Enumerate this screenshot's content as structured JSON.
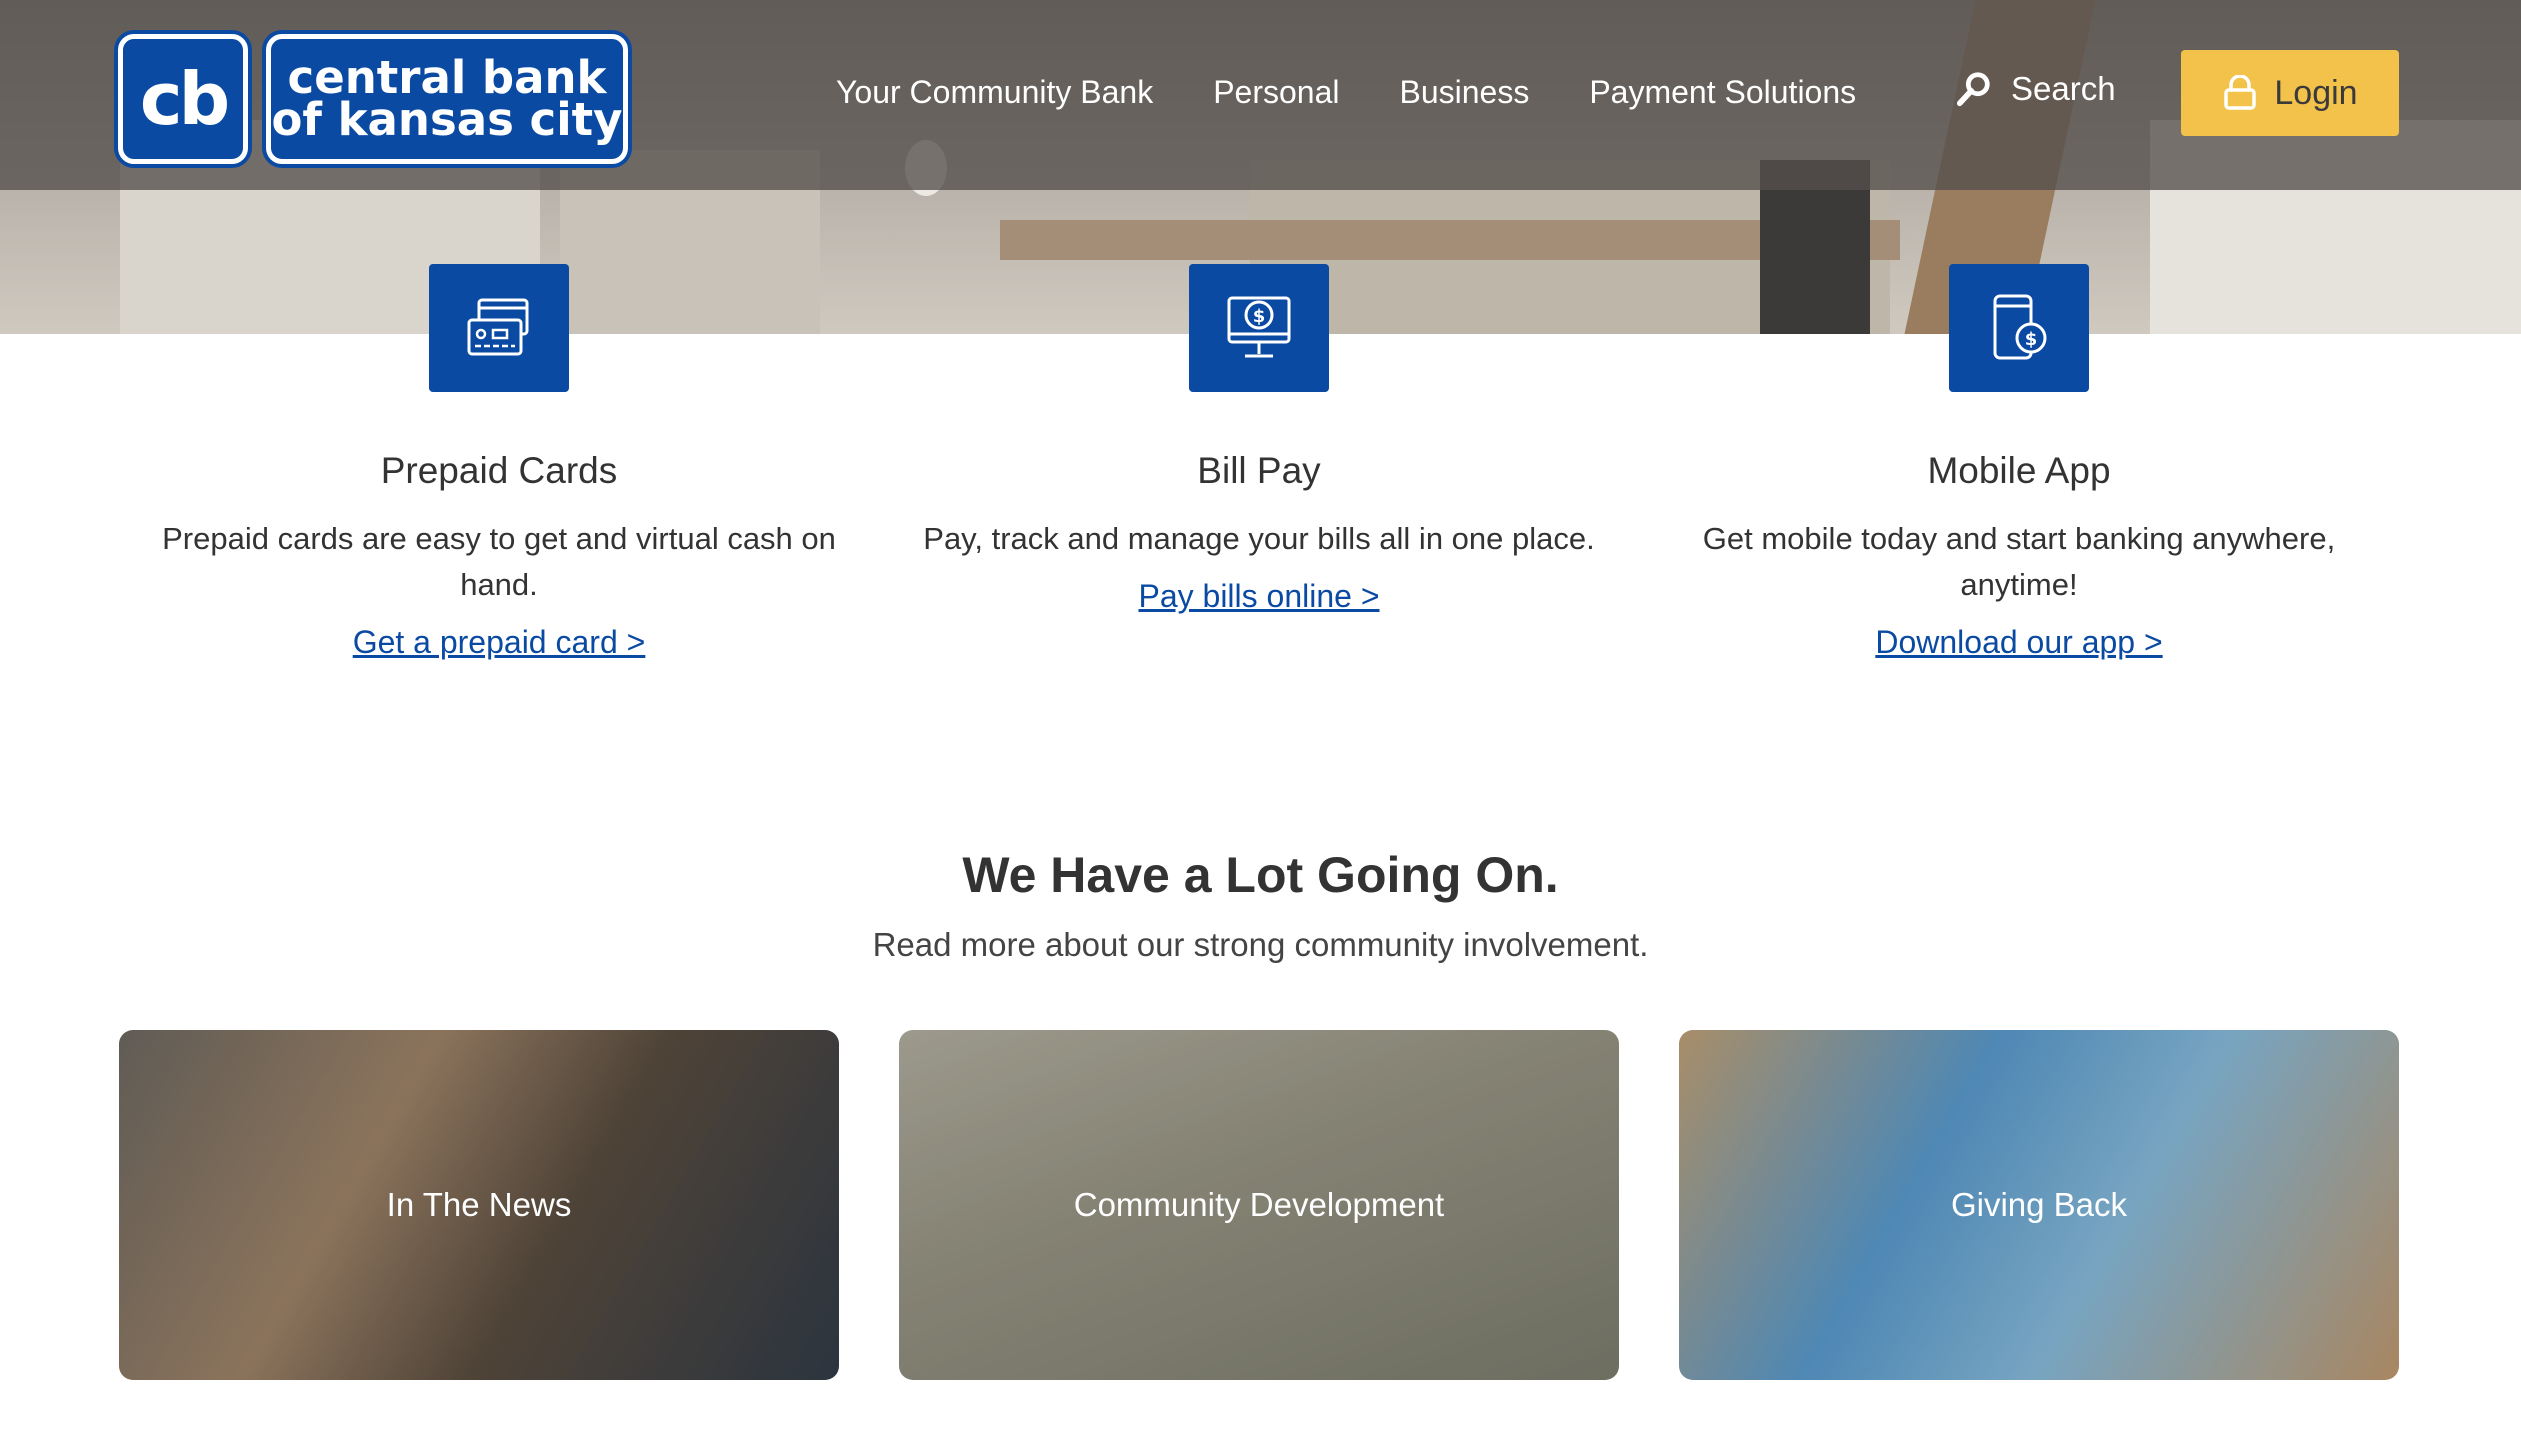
{
  "header": {
    "logo_mark": "cb",
    "logo_line1": "central bank",
    "logo_line2": "of kansas city",
    "nav": [
      "Your Community Bank",
      "Personal",
      "Business",
      "Payment Solutions"
    ],
    "search_label": "Search",
    "login_label": "Login"
  },
  "features": [
    {
      "icon": "prepaid-card-icon",
      "title": "Prepaid Cards",
      "text": "Prepaid cards are easy to get and virtual cash on hand.",
      "link": "Get a prepaid card >"
    },
    {
      "icon": "bill-pay-monitor-icon",
      "title": "Bill Pay",
      "text": "Pay, track and manage your bills all in one place.",
      "link": "Pay bills online >"
    },
    {
      "icon": "mobile-dollar-icon",
      "title": "Mobile App",
      "text": "Get mobile today and start banking anywhere, anytime!",
      "link": "Download our app >"
    }
  ],
  "section": {
    "title": "We Have a Lot Going On.",
    "subtitle": "Read more about our strong community involvement."
  },
  "cards": [
    "In The News",
    "Community Development",
    "Giving Back"
  ],
  "colors": {
    "brand_blue": "#0a4aa3",
    "login_yellow": "#f2c24b"
  }
}
